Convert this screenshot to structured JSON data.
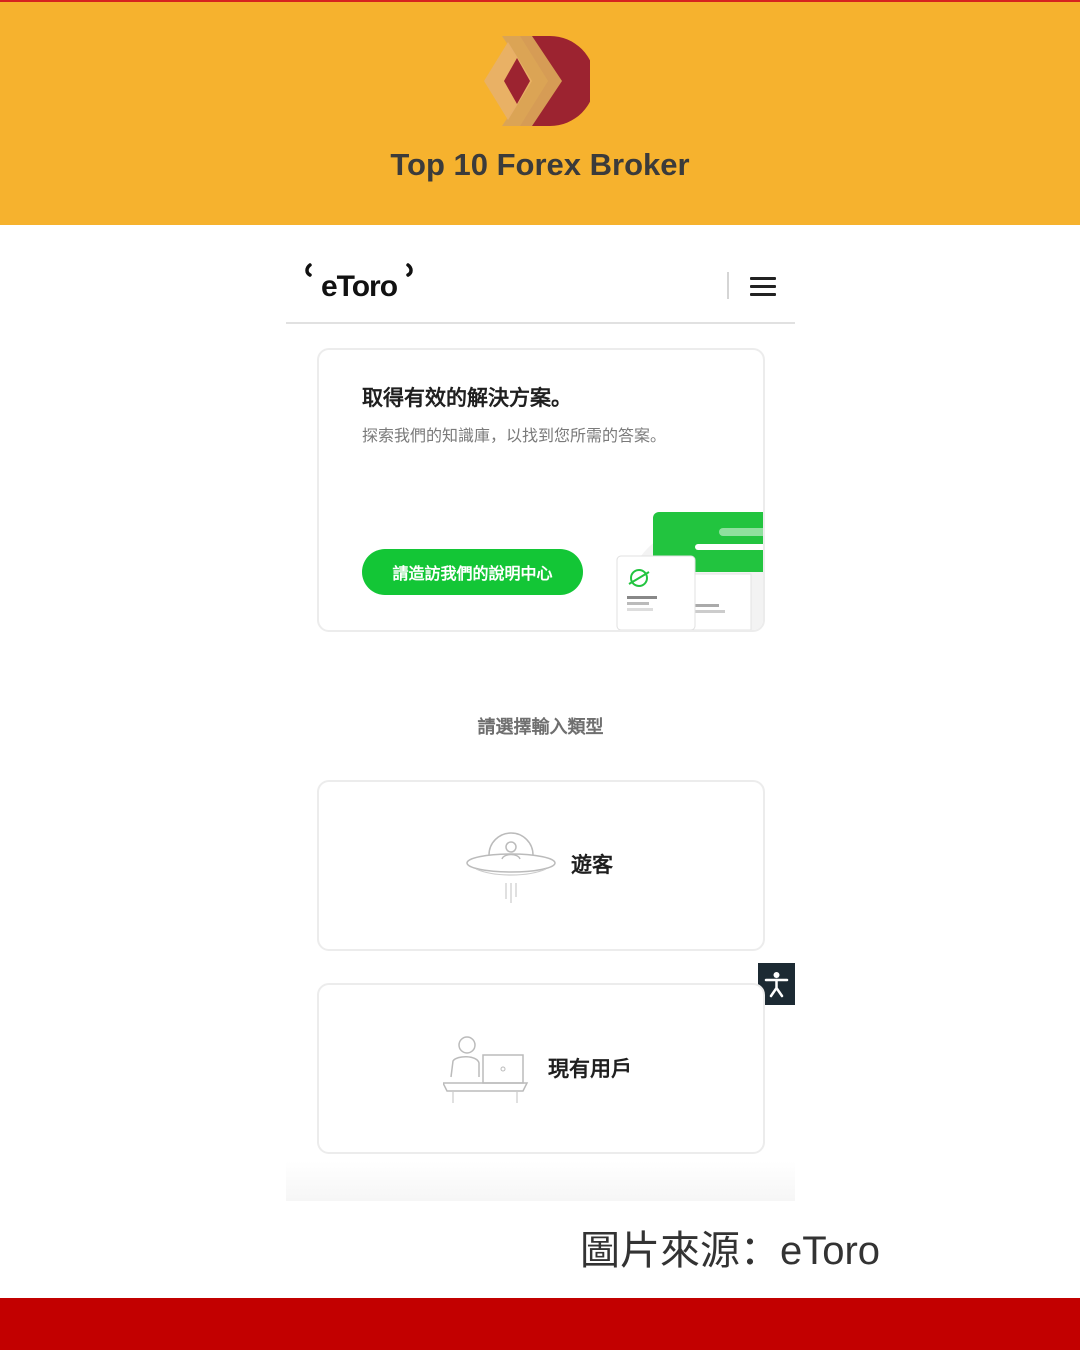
{
  "banner": {
    "title": "Top 10 Forex Broker",
    "logo_icon": "red-diamond-chevron-logo",
    "background_color": "#f6b22e"
  },
  "app": {
    "logo_text": "eToro",
    "menu_icon": "hamburger-menu-icon"
  },
  "help_card": {
    "title": "取得有效的解決方案。",
    "subtitle": "探索我們的知識庫，以找到您所需的答案。",
    "button_label": "請造訪我們的說明中心",
    "accent_color": "#13c636"
  },
  "entry_type": {
    "label": "請選擇輸入類型",
    "options": [
      {
        "label": "遊客",
        "icon": "ufo-guest-icon"
      },
      {
        "label": "現有用戶",
        "icon": "desk-user-icon"
      }
    ]
  },
  "accessibility_icon": "accessibility-icon",
  "caption": "圖片來源：eToro",
  "footer_color": "#c20000"
}
